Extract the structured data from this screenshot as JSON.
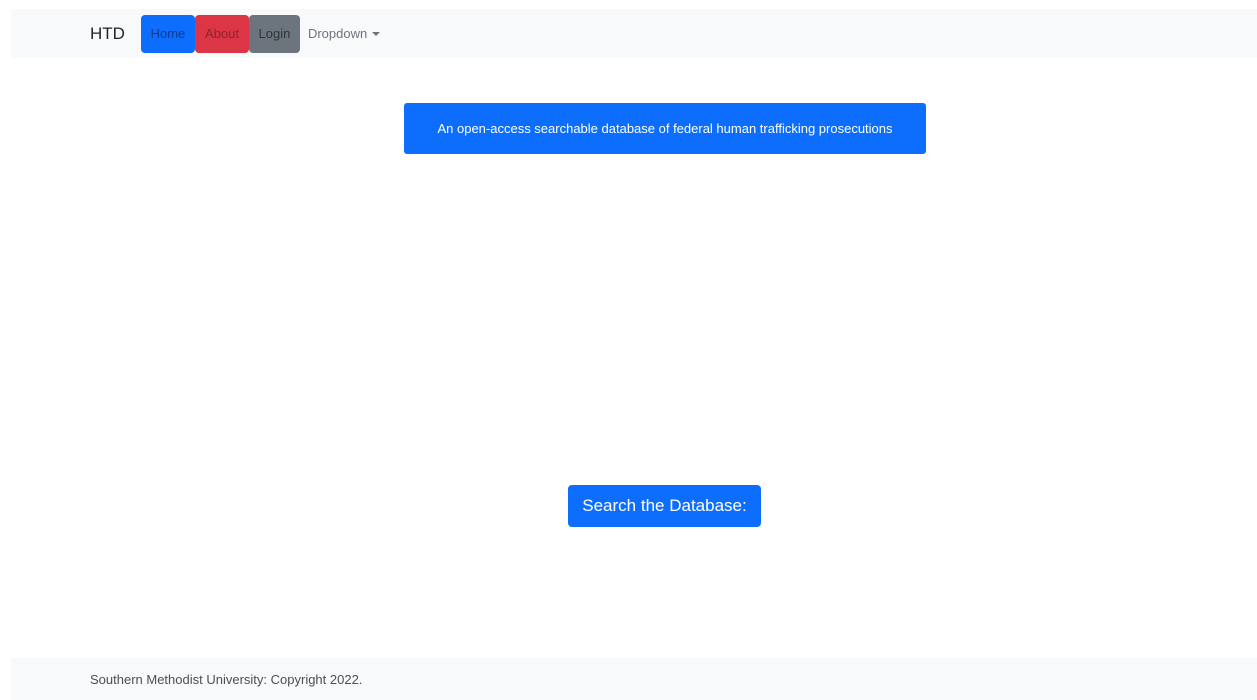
{
  "navbar": {
    "brand": "HTD",
    "items": [
      {
        "label": "Home",
        "color": "#0d6efd"
      },
      {
        "label": "About",
        "color": "#dc3545"
      },
      {
        "label": "Login",
        "color": "#6c757d"
      }
    ],
    "dropdown_label": "Dropdown",
    "background": "#f8f9fa"
  },
  "main": {
    "tagline": "An open-access searchable database of federal human trafficking prosecutions",
    "search_button": "Search the Database:",
    "accent": "#0d6efd"
  },
  "footer": {
    "text": "Southern Methodist University: Copyright 2022."
  }
}
